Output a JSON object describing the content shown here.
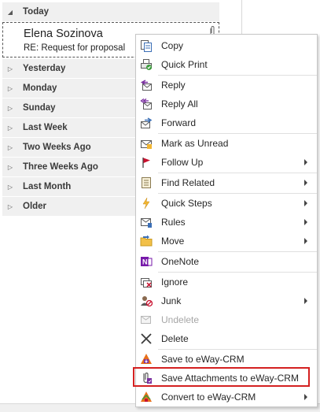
{
  "groups": [
    {
      "label": "Today",
      "expanded": true
    },
    {
      "label": "Yesterday",
      "expanded": false
    },
    {
      "label": "Monday",
      "expanded": false
    },
    {
      "label": "Sunday",
      "expanded": false
    },
    {
      "label": "Last Week",
      "expanded": false
    },
    {
      "label": "Two Weeks Ago",
      "expanded": false
    },
    {
      "label": "Three Weeks Ago",
      "expanded": false
    },
    {
      "label": "Last Month",
      "expanded": false
    },
    {
      "label": "Older",
      "expanded": false
    }
  ],
  "message": {
    "sender": "Elena Sozinova",
    "subject": "RE: Request for proposal",
    "has_attachment": true
  },
  "context_menu": {
    "items": [
      {
        "label": "Copy",
        "icon": "copy-icon",
        "submenu": false,
        "enabled": true
      },
      {
        "label": "Quick Print",
        "icon": "quick-print-icon",
        "submenu": false,
        "enabled": true
      },
      {
        "label": "Reply",
        "icon": "reply-icon",
        "submenu": false,
        "enabled": true
      },
      {
        "label": "Reply All",
        "icon": "reply-all-icon",
        "submenu": false,
        "enabled": true
      },
      {
        "label": "Forward",
        "icon": "forward-icon",
        "submenu": false,
        "enabled": true
      },
      {
        "label": "Mark as Unread",
        "icon": "mark-unread-icon",
        "submenu": false,
        "enabled": true
      },
      {
        "label": "Follow Up",
        "icon": "flag-icon",
        "submenu": true,
        "enabled": true
      },
      {
        "label": "Find Related",
        "icon": "find-related-icon",
        "submenu": true,
        "enabled": true
      },
      {
        "label": "Quick Steps",
        "icon": "lightning-icon",
        "submenu": true,
        "enabled": true
      },
      {
        "label": "Rules",
        "icon": "rules-icon",
        "submenu": true,
        "enabled": true
      },
      {
        "label": "Move",
        "icon": "move-folder-icon",
        "submenu": true,
        "enabled": true
      },
      {
        "label": "OneNote",
        "icon": "onenote-icon",
        "submenu": false,
        "enabled": true
      },
      {
        "label": "Ignore",
        "icon": "ignore-icon",
        "submenu": false,
        "enabled": true
      },
      {
        "label": "Junk",
        "icon": "junk-icon",
        "submenu": true,
        "enabled": true
      },
      {
        "label": "Undelete",
        "icon": "undelete-icon",
        "submenu": false,
        "enabled": false
      },
      {
        "label": "Delete",
        "icon": "delete-x-icon",
        "submenu": false,
        "enabled": true
      },
      {
        "label": "Save to eWay-CRM",
        "icon": "eway-save-icon",
        "submenu": false,
        "enabled": true
      },
      {
        "label": "Save Attachments to eWay-CRM",
        "icon": "eway-attachments-icon",
        "submenu": false,
        "enabled": true,
        "highlighted": true
      },
      {
        "label": "Convert to eWay-CRM",
        "icon": "eway-convert-icon",
        "submenu": true,
        "enabled": true
      }
    ]
  },
  "colors": {
    "highlight_border": "#d42020",
    "flag_red": "#c8102e",
    "onenote_purple": "#7719aa",
    "eway_orange": "#e8701a"
  }
}
